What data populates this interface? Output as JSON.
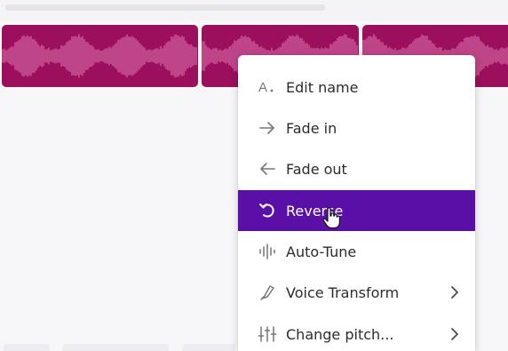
{
  "theme": {
    "clip_color": "#9b0f5c",
    "waveform_color": "#e27bb3",
    "menu_active_color": "#5a0fa6"
  },
  "context_menu": {
    "items": [
      {
        "label": "Edit name",
        "icon": "text-cursor-icon",
        "glyph": "A.",
        "has_submenu": false,
        "active": false
      },
      {
        "label": "Fade in",
        "icon": "arrow-right-icon",
        "glyph": "→",
        "has_submenu": false,
        "active": false
      },
      {
        "label": "Fade out",
        "icon": "arrow-left-icon",
        "glyph": "←",
        "has_submenu": false,
        "active": false
      },
      {
        "label": "Reverse",
        "icon": "reverse-icon",
        "glyph": "",
        "has_submenu": false,
        "active": true
      },
      {
        "label": "Auto-Tune",
        "icon": "auto-tune-icon",
        "glyph": "",
        "has_submenu": false,
        "active": false
      },
      {
        "label": "Voice Transform",
        "icon": "voice-transform-icon",
        "glyph": "",
        "has_submenu": true,
        "active": false
      },
      {
        "label": "Change pitch...",
        "icon": "sliders-icon",
        "glyph": "",
        "has_submenu": true,
        "active": false
      }
    ]
  }
}
